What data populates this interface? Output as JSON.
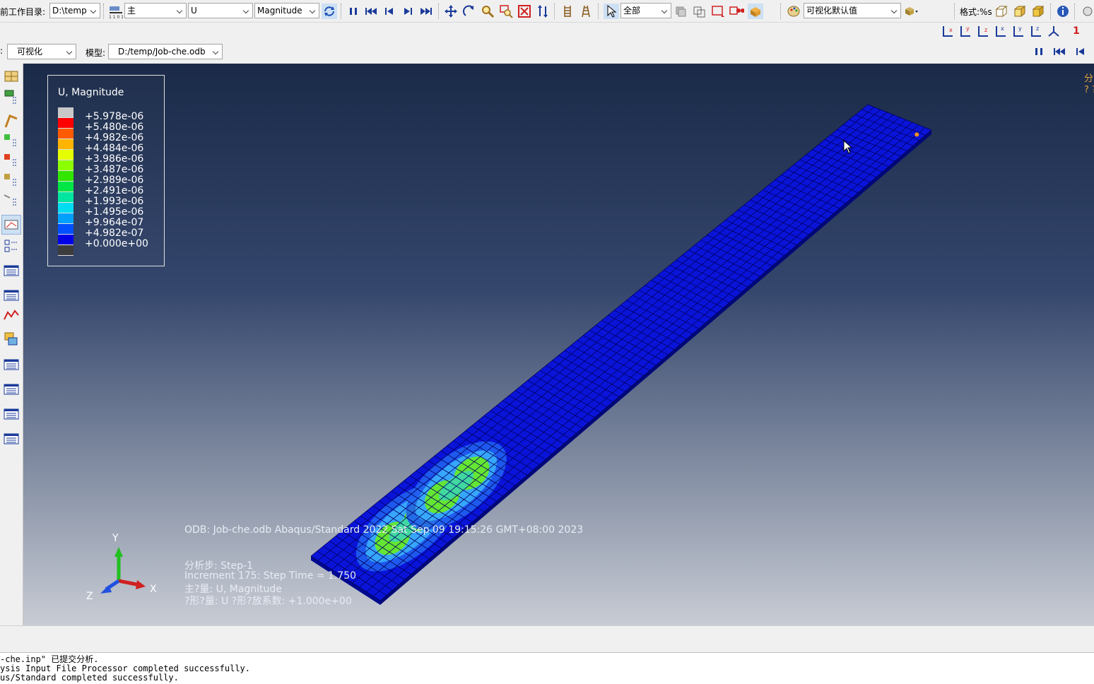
{
  "toolbar": {
    "workdir_label": "前工作目录:",
    "workdir_value": "D:\\temp",
    "primary_select": "主",
    "variable_select": "U",
    "invariant_select": "Magnitude",
    "selection_filter": "全部",
    "view_defaults": "可视化默认值",
    "format_label": "格式:%s",
    "axis_number": "1"
  },
  "toolbar2": {
    "module_value": "可视化",
    "model_label": "模型:",
    "model_value": "D:/temp/Job-che.odb"
  },
  "legend": {
    "title": "U, Magnitude",
    "entries": [
      {
        "value": "+5.978e-06",
        "color": "#c8c8c8"
      },
      {
        "value": "+5.480e-06",
        "color": "#ff0000"
      },
      {
        "value": "+4.982e-06",
        "color": "#ff5a00"
      },
      {
        "value": "+4.484e-06",
        "color": "#ffb400"
      },
      {
        "value": "+3.986e-06",
        "color": "#e6ff00"
      },
      {
        "value": "+3.487e-06",
        "color": "#8cff00"
      },
      {
        "value": "+2.989e-06",
        "color": "#32e600"
      },
      {
        "value": "+2.491e-06",
        "color": "#00e646"
      },
      {
        "value": "+1.993e-06",
        "color": "#00e6a0"
      },
      {
        "value": "+1.495e-06",
        "color": "#00dcf0"
      },
      {
        "value": "+9.964e-07",
        "color": "#00a0ff"
      },
      {
        "value": "+4.982e-07",
        "color": "#0050ff"
      },
      {
        "value": "+0.000e+00",
        "color": "#0000e6"
      }
    ],
    "bottom_color": "#3c3c3c"
  },
  "viewport_info": {
    "odb_line": "ODB: Job-che.odb    Abaqus/Standard 2022    Sat Sep 09 19:15:26 GMT+08:00 2023",
    "step_line": "分析步: Step-1",
    "increment_line": "Increment    175: Step Time =    1.750",
    "primary_var_line": "主?量: U, Magnitude",
    "deformed_line": "?形?量: U   ?形?放系数: +1.000e+00"
  },
  "triad": {
    "y": "Y",
    "x": "X",
    "z": "Z"
  },
  "corner": {
    "line1": "分",
    "line2": "? ?"
  },
  "messages": [
    "-che.inp\" 已提交分析.",
    "ysis Input File Processor completed successfully.",
    "us/Standard completed successfully."
  ],
  "colors": {
    "mesh_base": "#0a14d8",
    "mesh_line": "#000060",
    "hot_green": "#64e632",
    "hot_cyan": "#3cb4ff"
  }
}
